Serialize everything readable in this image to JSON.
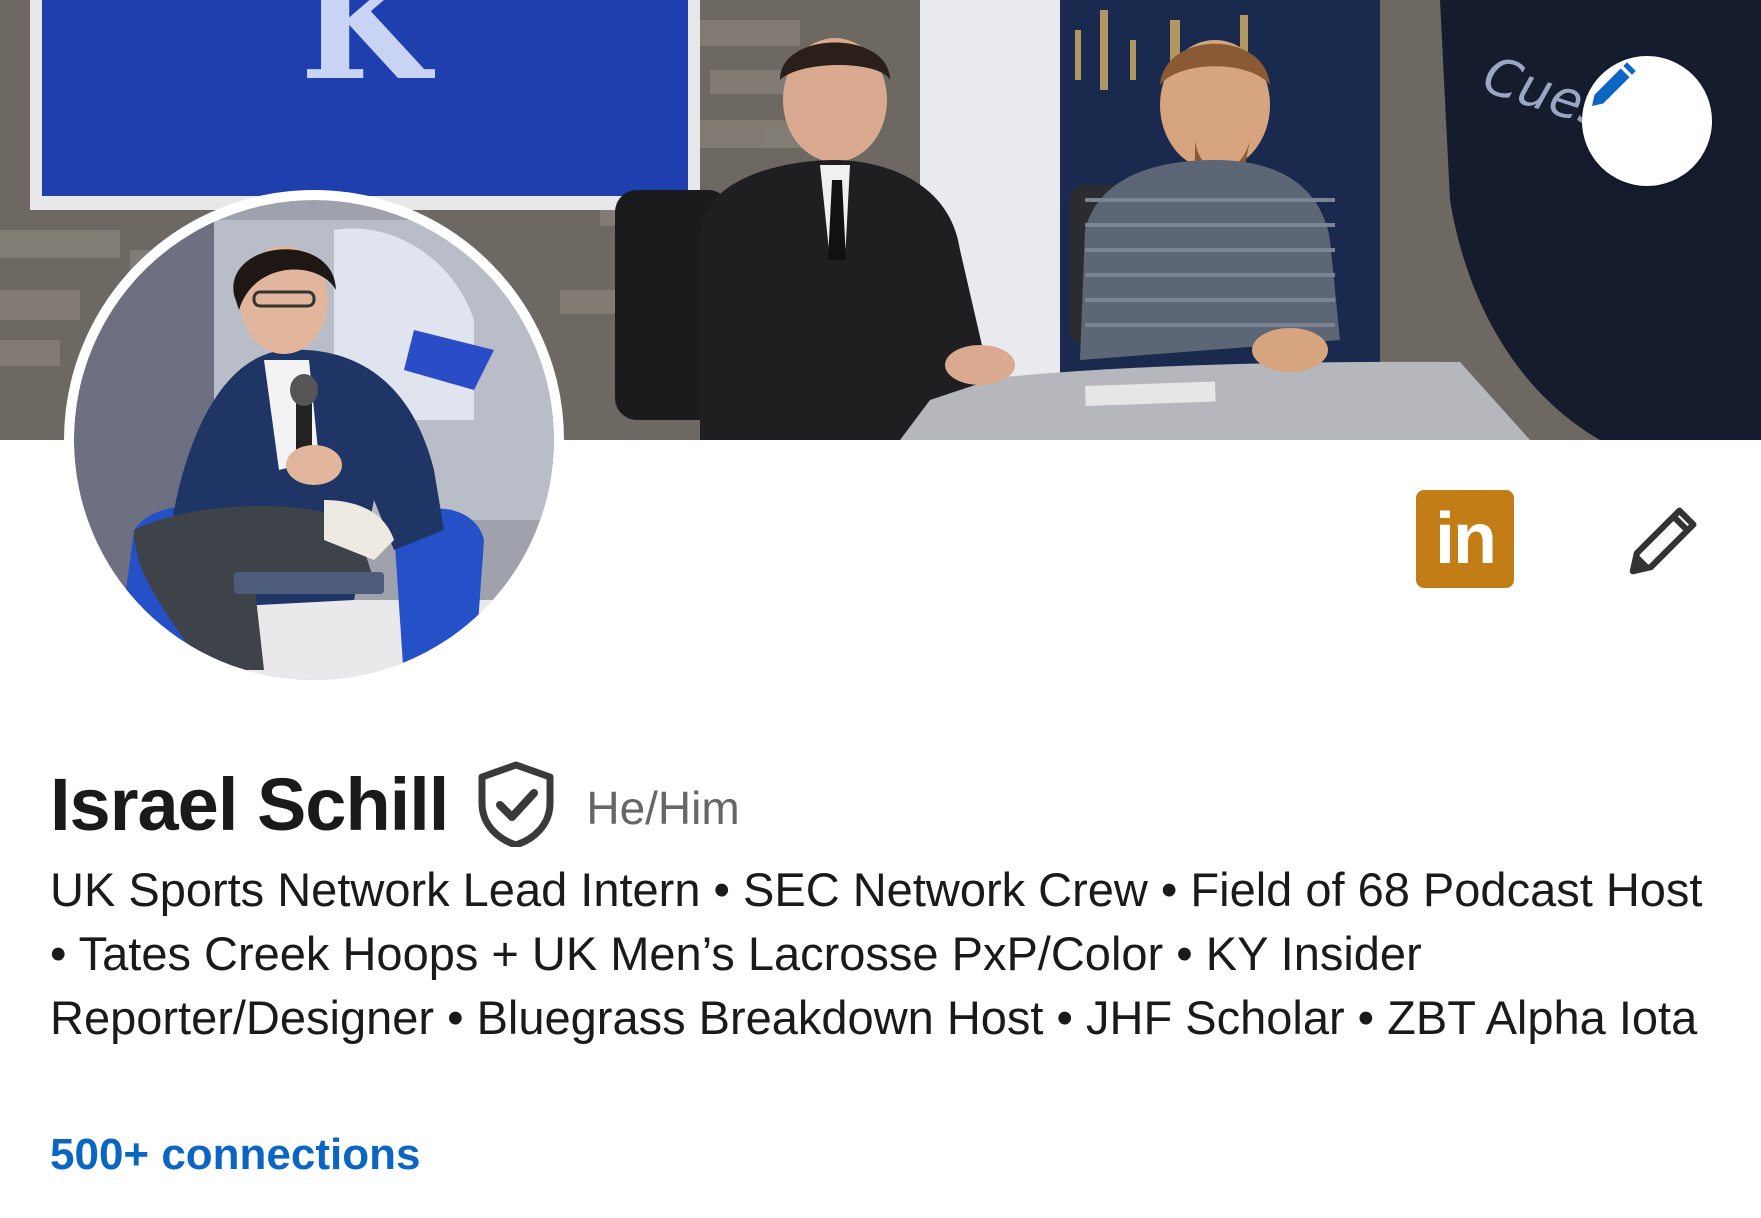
{
  "profile": {
    "name": "Israel Schill",
    "pronouns": "He/Him",
    "headline": "UK Sports Network Lead Intern • SEC Network Crew • Field of 68 Podcast Host • Tates Creek Hoops + UK Men’s Lacrosse PxP/Color • KY Insider Reporter/Designer • Bluegrass Breakdown Host • JHF Scholar • ZBT Alpha Iota",
    "connections": "500+ connections"
  },
  "icons": {
    "cover_edit": "pencil-icon",
    "linkedin_badge": "linkedin-icon",
    "linkedin_text": "in",
    "profile_edit": "pencil-icon",
    "verified": "shield-check-icon"
  },
  "colors": {
    "accent": "#0a66c2",
    "linkedin_badge": "#c37d16",
    "text_primary": "#1a1a1a",
    "text_secondary": "#666666"
  }
}
